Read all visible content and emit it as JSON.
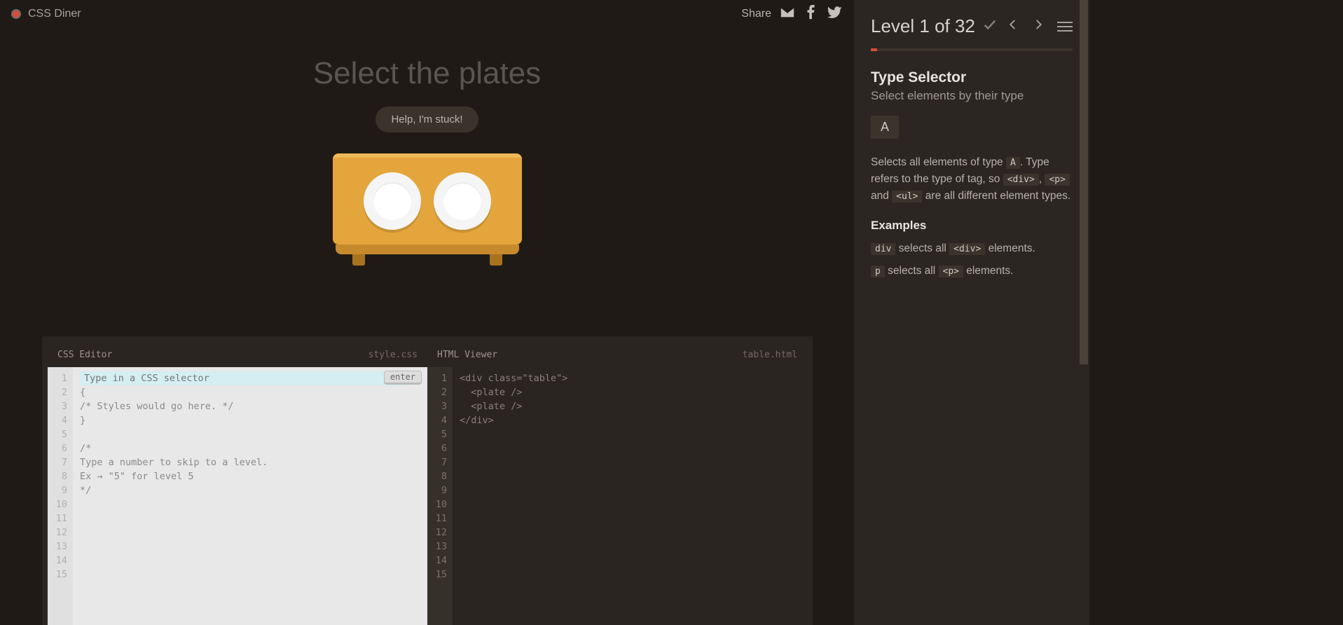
{
  "app": {
    "title": "CSS Diner"
  },
  "share": {
    "label": "Share"
  },
  "page": {
    "title": "Select the plates",
    "help_button": "Help, I'm stuck!"
  },
  "editors": {
    "css": {
      "title": "CSS Editor",
      "filename": "style.css",
      "enter": "enter",
      "placeholder": "Type in a CSS selector",
      "lines": [
        "",
        "{",
        "/* Styles would go here. */",
        "}",
        "",
        "/*",
        "Type a number to skip to a level.",
        "Ex → \"5\" for level 5",
        "*/",
        "",
        "",
        "",
        "",
        "",
        ""
      ],
      "line_count": 15
    },
    "html": {
      "title": "HTML Viewer",
      "filename": "table.html",
      "lines": [
        "<div class=\"table\">",
        "  <plate />",
        "  <plate />",
        "</div>",
        "",
        "",
        "",
        "",
        "",
        "",
        "",
        "",
        "",
        "",
        ""
      ],
      "line_count": 15
    }
  },
  "sidebar": {
    "level_label": "Level 1 of 32",
    "lesson_title": "Type Selector",
    "lesson_subtitle": "Select elements by their type",
    "syntax": "A",
    "desc_pre": "Selects all elements of type ",
    "desc_A": "A",
    "desc_mid": ". Type refers to the type of tag, so ",
    "tag_div": "<div>",
    "sep1": ", ",
    "tag_p": "<p>",
    "sep2": " and ",
    "tag_ul": "<ul>",
    "desc_post": " are all different element types.",
    "examples_h": "Examples",
    "ex1_code": "div",
    "ex1_mid": " selects all ",
    "ex1_tag": "<div>",
    "ex1_post": " elements.",
    "ex2_code": "p",
    "ex2_mid": " selects all ",
    "ex2_tag": "<p>",
    "ex2_post": " elements."
  }
}
